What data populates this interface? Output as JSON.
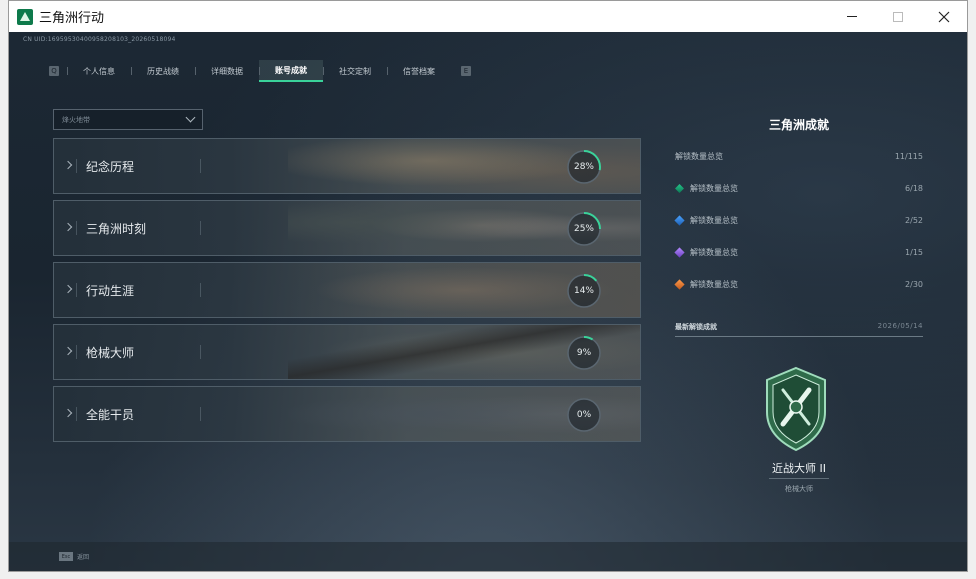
{
  "window": {
    "title": "三角洲行动"
  },
  "game": {
    "uid_text": "CN UID:16959530400958208103_20260518094"
  },
  "tabs": {
    "left_key": "Q",
    "right_key": "E",
    "items": [
      {
        "label": "个人信息"
      },
      {
        "label": "历史战绩"
      },
      {
        "label": "详细数据"
      },
      {
        "label": "账号成就",
        "active": true
      },
      {
        "label": "社交定制"
      },
      {
        "label": "信誉档案"
      }
    ]
  },
  "filter": {
    "label": "烽火地带"
  },
  "categories": [
    {
      "label": "纪念历程",
      "percent": 28,
      "percent_text": "28%"
    },
    {
      "label": "三角洲时刻",
      "percent": 25,
      "percent_text": "25%"
    },
    {
      "label": "行动生涯",
      "percent": 14,
      "percent_text": "14%"
    },
    {
      "label": "枪械大师",
      "percent": 9,
      "percent_text": "9%"
    },
    {
      "label": "全能干员",
      "percent": 0,
      "percent_text": "0%"
    }
  ],
  "panel": {
    "title": "三角洲成就",
    "summary_total": {
      "label": "解锁数量总览",
      "value": "11/115"
    },
    "summary_rows": [
      {
        "icon": "green-gem-icon",
        "label": "解锁数量总览",
        "value": "6/18"
      },
      {
        "icon": "blue-gem-icon",
        "label": "解锁数量总览",
        "value": "2/52"
      },
      {
        "icon": "purple-gem-icon",
        "label": "解锁数量总览",
        "value": "1/15"
      },
      {
        "icon": "orange-gem-icon",
        "label": "解锁数量总览",
        "value": "2/30"
      }
    ],
    "latest": {
      "label": "最新解锁成就",
      "date": "2026/05/14"
    },
    "badge": {
      "name": "近战大师 II",
      "sub": "枪械大师"
    }
  },
  "bottom": {
    "esc_key": "Esc",
    "esc_label": "返回"
  },
  "colors": {
    "accent": "#3ad29a",
    "ring_track": "#5a6670"
  }
}
